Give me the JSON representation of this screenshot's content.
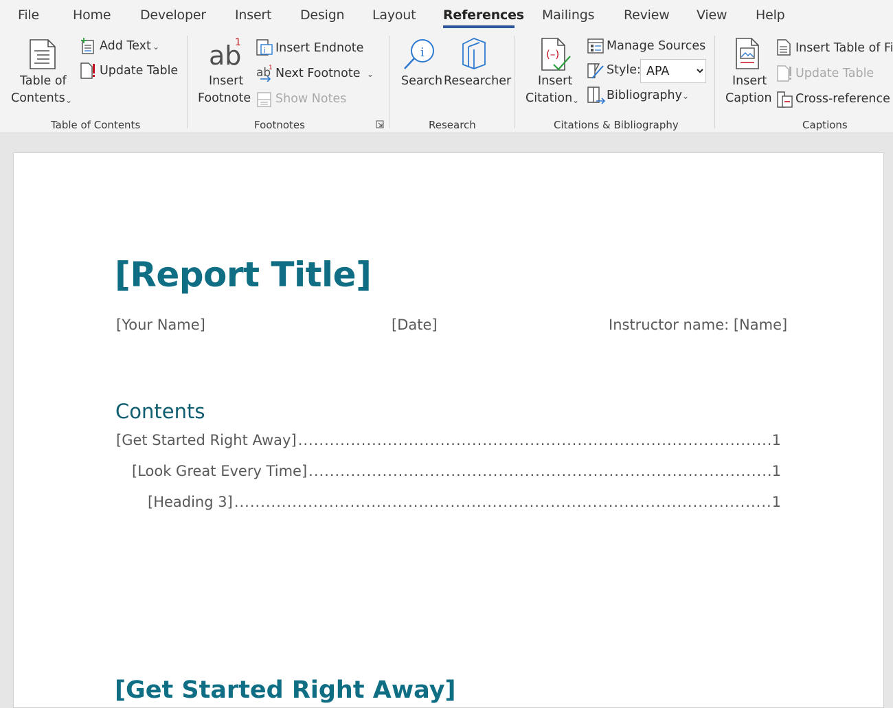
{
  "menu": {
    "tabs": [
      "File",
      "Home",
      "Developer",
      "Insert",
      "Design",
      "Layout",
      "References",
      "Mailings",
      "Review",
      "View",
      "Help"
    ],
    "active": "References"
  },
  "ribbon": {
    "toc_group": {
      "table_of_contents_line1": "Table of",
      "table_of_contents_line2": "Contents",
      "add_text": "Add Text",
      "update_table": "Update Table",
      "label": "Table of Contents"
    },
    "footnotes_group": {
      "insert_footnote_line1": "Insert",
      "insert_footnote_line2": "Footnote",
      "insert_endnote": "Insert Endnote",
      "next_footnote": "Next Footnote",
      "show_notes": "Show Notes",
      "label": "Footnotes"
    },
    "research_group": {
      "search": "Search",
      "researcher": "Researcher",
      "label": "Research"
    },
    "citations_group": {
      "insert_citation_line1": "Insert",
      "insert_citation_line2": "Citation",
      "manage_sources": "Manage Sources",
      "style_label": "Style:",
      "style_value": "APA",
      "bibliography": "Bibliography",
      "label": "Citations & Bibliography"
    },
    "captions_group": {
      "insert_caption_line1": "Insert",
      "insert_caption_line2": "Caption",
      "insert_table_of_figures": "Insert Table of Fig",
      "update_table": "Update Table",
      "cross_reference": "Cross-reference",
      "label": "Captions"
    }
  },
  "document": {
    "title": "[Report Title]",
    "your_name": "[Your Name]",
    "date": "[Date]",
    "instructor": "Instructor name: [Name]",
    "contents_heading": "Contents",
    "toc": [
      {
        "text": "[Get Started Right Away]",
        "page": "1"
      },
      {
        "text": "[Look Great Every Time]",
        "page": "1"
      },
      {
        "text": "[Heading 3]",
        "page": "1"
      }
    ],
    "section_heading": "[Get Started Right Away]"
  },
  "colors": {
    "accent": "#2b579a",
    "heading": "#0f6e84",
    "icon_blue": "#2e7ad1"
  }
}
